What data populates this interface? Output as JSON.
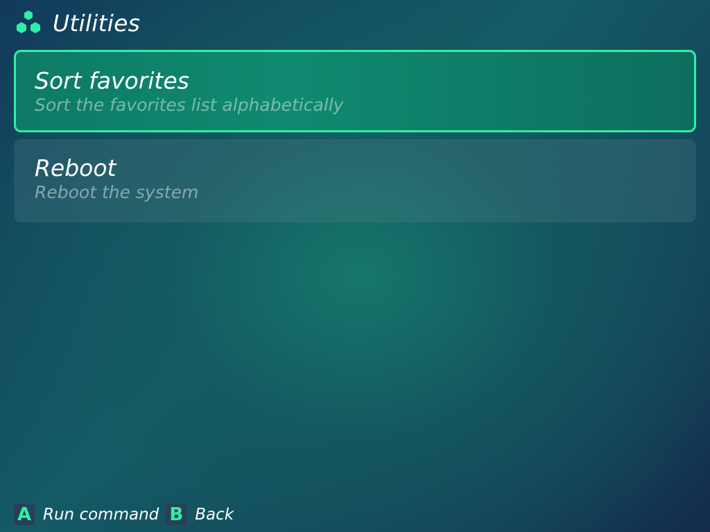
{
  "header": {
    "title": "Utilities",
    "icon": "hexagons-icon",
    "accent_color": "#2ff0a6"
  },
  "menu": {
    "items": [
      {
        "title": "Sort favorites",
        "description": "Sort the favorites list alphabetically",
        "selected": true
      },
      {
        "title": "Reboot",
        "description": "Reboot the system",
        "selected": false
      }
    ]
  },
  "footer": {
    "hints": [
      {
        "key": "A",
        "label": "Run command"
      },
      {
        "key": "B",
        "label": "Back"
      }
    ]
  }
}
